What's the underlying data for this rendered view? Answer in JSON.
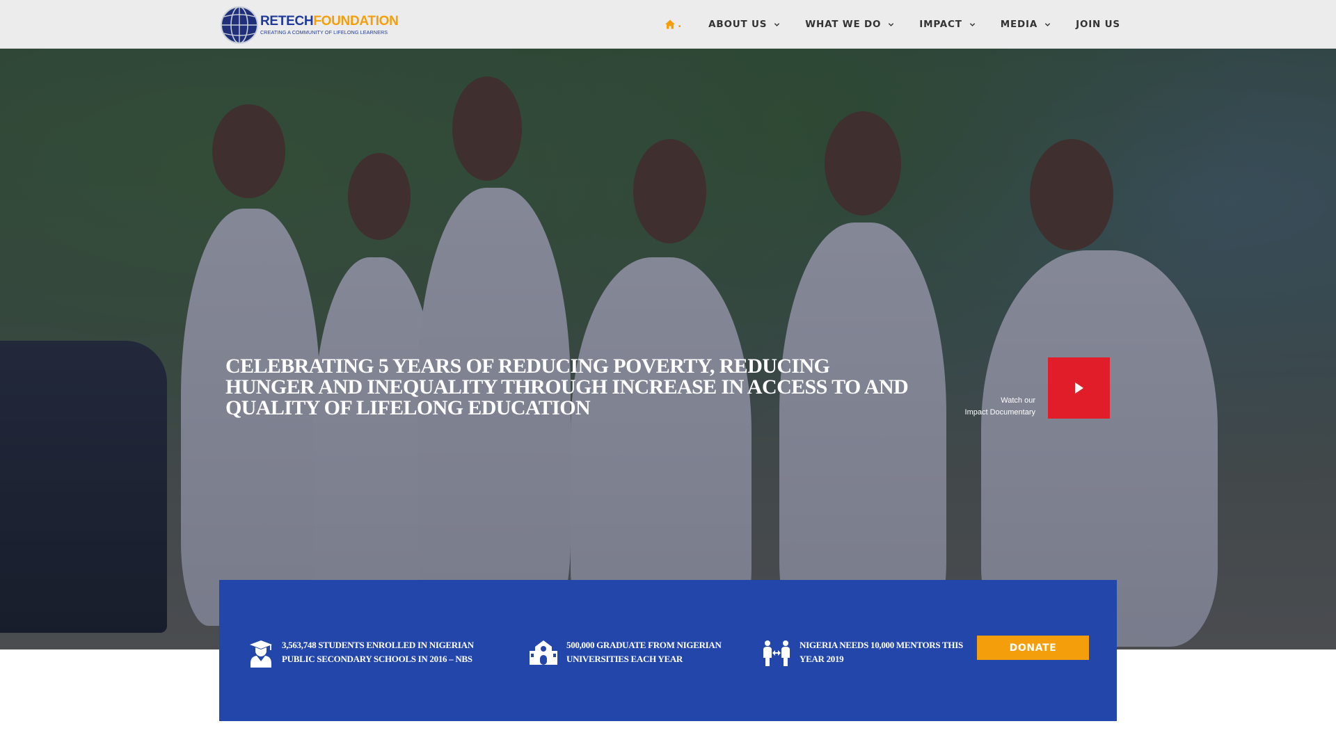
{
  "header": {
    "logo": {
      "name_part1": "RETECH",
      "name_part2": "FOUNDATION",
      "tagline": "CREATING A COMMUNITY OF LIFELONG LEARNERS"
    },
    "nav": {
      "home_icon": "home-icon",
      "home_label": ".",
      "items": [
        {
          "label": "ABOUT US",
          "has_dropdown": true
        },
        {
          "label": "WHAT WE DO",
          "has_dropdown": true
        },
        {
          "label": "IMPACT",
          "has_dropdown": true
        },
        {
          "label": "MEDIA",
          "has_dropdown": true
        },
        {
          "label": "JOIN US",
          "has_dropdown": false
        }
      ]
    }
  },
  "hero": {
    "headline": "CELEBRATING 5 YEARS OF REDUCING POVERTY, REDUCING HUNGER AND INEQUALITY THROUGH INCREASE IN ACCESS TO AND QUALITY OF LIFELONG EDUCATION",
    "watch_line1": "Watch our",
    "watch_line2": "Impact Documentary",
    "play_icon": "play-icon"
  },
  "stats": {
    "items": [
      {
        "icon": "graduate-icon",
        "text": "3,563,748 STUDENTS ENROLLED IN NIGERIAN PUBLIC SECONDARY SCHOOLS IN 2016 – NBS"
      },
      {
        "icon": "school-building-icon",
        "text": "500,000 GRADUATE FROM NIGERIAN UNIVERSITIES EACH YEAR"
      },
      {
        "icon": "mentorship-icon",
        "text": "NIGERIA NEEDS 10,000 MENTORS THIS YEAR 2019"
      }
    ],
    "donate_label": "DONATE"
  },
  "colors": {
    "accent_orange": "#f59e0b",
    "brand_blue": "#2346aa",
    "play_red": "#e11d2a",
    "header_bg": "#ececec"
  }
}
